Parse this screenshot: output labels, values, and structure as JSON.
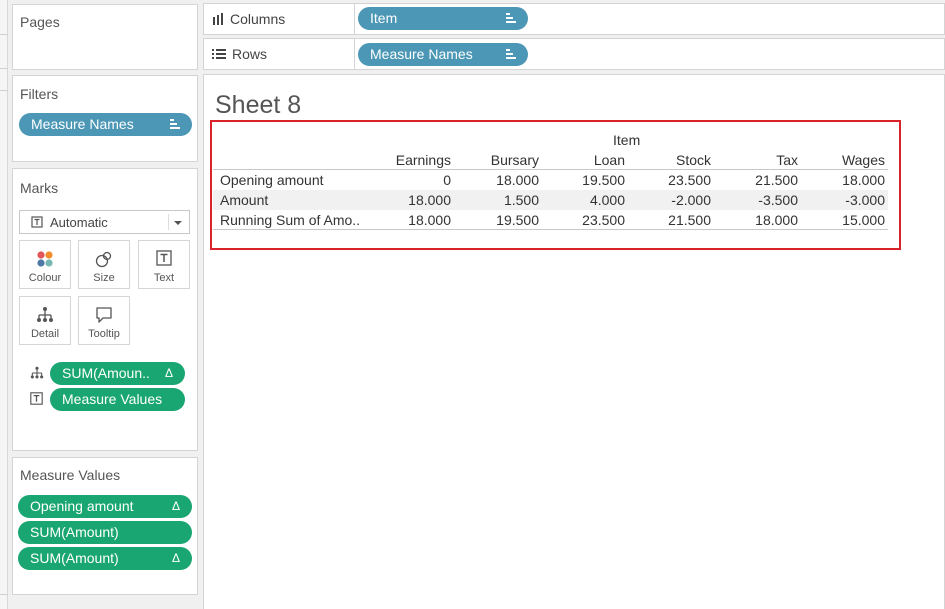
{
  "pages_card": {
    "title": "Pages"
  },
  "shelves": {
    "columns": {
      "label": "Columns",
      "icon": "columns-icon",
      "pill": "Item"
    },
    "rows": {
      "label": "Rows",
      "icon": "rows-icon",
      "pill": "Measure Names"
    }
  },
  "filters_card": {
    "title": "Filters",
    "pills": [
      {
        "label": "Measure Names"
      }
    ]
  },
  "marks_card": {
    "title": "Marks",
    "mark_type": "Automatic",
    "buttons": [
      {
        "label": "Colour",
        "icon": "colour-icon"
      },
      {
        "label": "Size",
        "icon": "size-icon"
      },
      {
        "label": "Text",
        "icon": "text-icon"
      },
      {
        "label": "Detail",
        "icon": "detail-icon"
      },
      {
        "label": "Tooltip",
        "icon": "tooltip-icon"
      }
    ],
    "fields": [
      {
        "label": "SUM(Amoun..",
        "icon": "detail-icon",
        "badge": "Δ"
      },
      {
        "label": "Measure Values",
        "icon": "text-icon"
      }
    ]
  },
  "measure_values_card": {
    "title": "Measure Values",
    "pills": [
      {
        "label": "Opening amount",
        "badge": "Δ"
      },
      {
        "label": "SUM(Amount)",
        "badge": ""
      },
      {
        "label": "SUM(Amount)",
        "badge": "Δ"
      }
    ]
  },
  "sheet": {
    "title": "Sheet 8",
    "header_group": "Item",
    "columns": [
      "Earnings",
      "Bursary",
      "Loan",
      "Stock",
      "Tax",
      "Wages"
    ],
    "rows": [
      {
        "label": "Opening amount",
        "values": [
          "0",
          "18.000",
          "19.500",
          "23.500",
          "21.500",
          "18.000"
        ]
      },
      {
        "label": "Amount",
        "values": [
          "18.000",
          "1.500",
          "4.000",
          "-2.000",
          "-3.500",
          "-3.000"
        ]
      },
      {
        "label": "Running Sum of Amo..",
        "values": [
          "18.000",
          "19.500",
          "23.500",
          "21.500",
          "18.000",
          "15.000"
        ]
      }
    ],
    "highlight_color": "#d9232a"
  },
  "colors": {
    "pill_blue": "#4b97b5",
    "pill_green": "#1aa672"
  }
}
